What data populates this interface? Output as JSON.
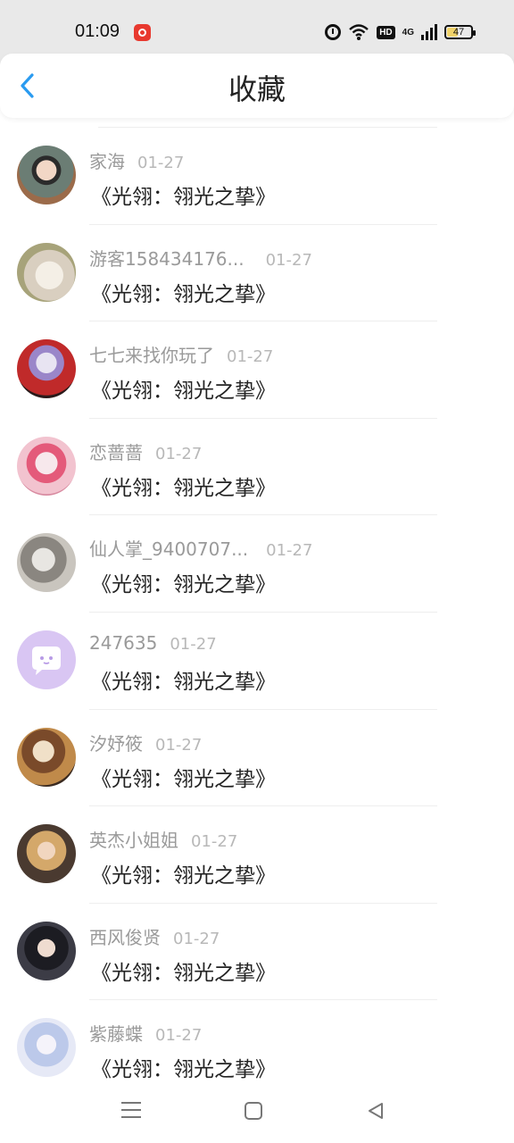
{
  "status_bar": {
    "time": "01:09",
    "network": "4G",
    "hd": "HD",
    "battery": "47",
    "battery_level": 0.47,
    "icons": [
      "app-notification-icon",
      "alarm-icon",
      "wifi-icon",
      "signal-icon",
      "battery-icon"
    ]
  },
  "header": {
    "title": "收藏",
    "back_icon": "chevron-left-icon",
    "accent_color": "#2a9bf0"
  },
  "favorites": [
    {
      "name": "家海",
      "date": "01-27",
      "title": "《光翎：翎光之挚》"
    },
    {
      "name": "游客158434176...",
      "date": "01-27",
      "title": "《光翎：翎光之挚》"
    },
    {
      "name": "七七来找你玩了",
      "date": "01-27",
      "title": "《光翎：翎光之挚》"
    },
    {
      "name": "恋蔷蔷",
      "date": "01-27",
      "title": "《光翎：翎光之挚》"
    },
    {
      "name": "仙人掌_9400707...",
      "date": "01-27",
      "title": "《光翎：翎光之挚》"
    },
    {
      "name": "247635",
      "date": "01-27",
      "title": "《光翎：翎光之挚》"
    },
    {
      "name": "汐妤筱",
      "date": "01-27",
      "title": "《光翎：翎光之挚》"
    },
    {
      "name": "英杰小姐姐",
      "date": "01-27",
      "title": "《光翎：翎光之挚》"
    },
    {
      "name": "西风俊贤",
      "date": "01-27",
      "title": "《光翎：翎光之挚》"
    },
    {
      "name": "紫藤蝶",
      "date": "01-27",
      "title": "《光翎：翎光之挚》"
    }
  ],
  "nav_bar": {
    "icons": [
      "menu-icon",
      "home-icon",
      "back-triangle-icon"
    ]
  }
}
